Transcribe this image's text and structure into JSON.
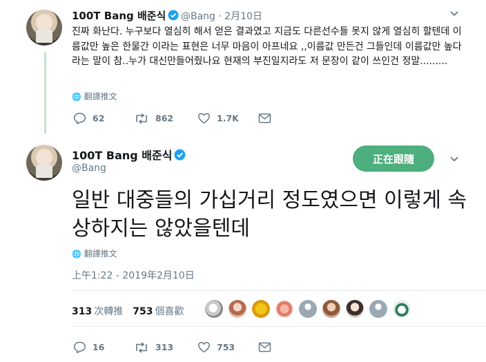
{
  "reply_tweet": {
    "display_name": "100T Bang 배준식",
    "handle": "@Bang",
    "date": "· 2月10日",
    "text": "진짜 화난다. 누구보다 열심히 해서 얻은 결과였고 지금도 다른선수들 못지 않게 열심히 할텐데 이름값만 높은 한물간 이라는 표현은 너무 마음이 아프네요 ,,이름값 만든건 그들인데 이름값만 높다 라는 말이 참..누가 대신만들어줬나요 현재의 부진일지라도 저 문장이 같이 쓰인건 정말.........",
    "translate_label": "翻譯推文",
    "replies": "62",
    "retweets": "862",
    "likes": "1.7K"
  },
  "main_tweet": {
    "display_name": "100T Bang 배준식",
    "handle": "@Bang",
    "follow_label": "正在跟隨",
    "text": "일반 대중들의 가십거리 정도였으면 이렇게 속상하지는 않았을텐데",
    "translate_label": "翻譯推文",
    "timestamp": "上午1:22 - 2019年2月10日",
    "retweet_count": "313",
    "retweet_label": "次轉推",
    "like_count": "753",
    "like_label": "個喜歡",
    "replies": "16",
    "retweets": "313",
    "likes": "753"
  },
  "icons": {
    "verified": "verified-badge-icon",
    "reply": "reply-icon",
    "retweet": "retweet-icon",
    "like": "heart-icon",
    "dm": "envelope-icon",
    "globe": "globe-icon",
    "more": "chevron-down-icon"
  },
  "colors": {
    "verified_blue": "#1da1f2",
    "follow_button": "#4caf7d",
    "thread_line": "#c4e0c9",
    "muted_text": "#657786"
  }
}
